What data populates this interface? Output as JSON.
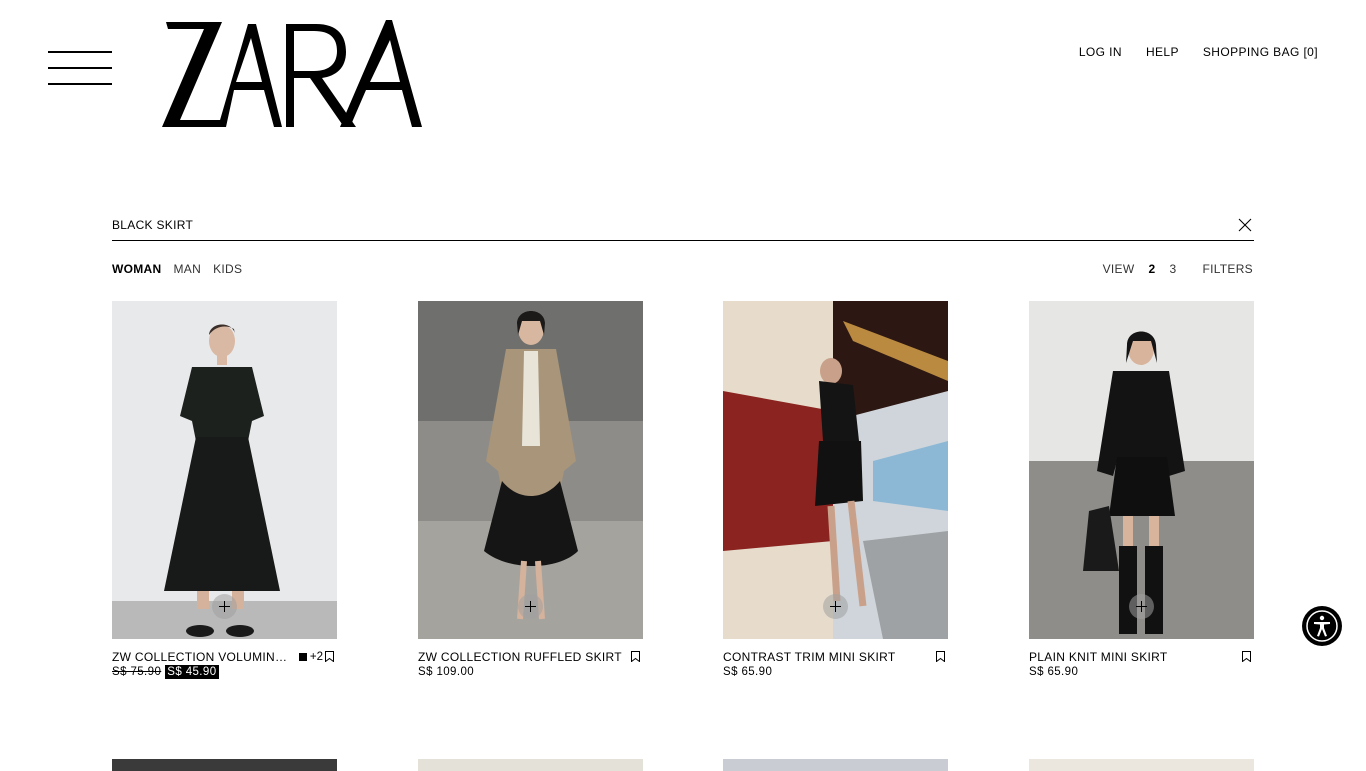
{
  "header": {
    "logo_text": "ZARA",
    "nav": {
      "login": "LOG IN",
      "help": "HELP",
      "bag": "SHOPPING BAG [0]"
    }
  },
  "search": {
    "value": "BLACK SKIRT"
  },
  "gender_tabs": [
    "WOMAN",
    "MAN",
    "KIDS"
  ],
  "active_gender": "WOMAN",
  "view": {
    "label": "VIEW",
    "options": [
      "2",
      "3"
    ],
    "active": "2",
    "filters_label": "FILTERS"
  },
  "products": [
    {
      "name": "ZW COLLECTION VOLUMINO...",
      "old_price": "S$ 75.90",
      "price": "S$ 45.90",
      "extra_colors": "+2",
      "on_sale": true
    },
    {
      "name": "ZW COLLECTION RUFFLED SKIRT",
      "price": "S$ 109.00"
    },
    {
      "name": "CONTRAST TRIM MINI SKIRT",
      "price": "S$ 65.90"
    },
    {
      "name": "PLAIN KNIT MINI SKIRT",
      "price": "S$ 65.90"
    }
  ],
  "colors": {
    "text": "#000000",
    "background": "#ffffff",
    "sale_bg": "#000000",
    "add_button": "#a0a0a0"
  },
  "icons": {
    "menu": "hamburger-icon",
    "clear": "close-icon",
    "add": "plus-icon",
    "save": "bookmark-icon",
    "accessibility": "accessibility-icon"
  }
}
